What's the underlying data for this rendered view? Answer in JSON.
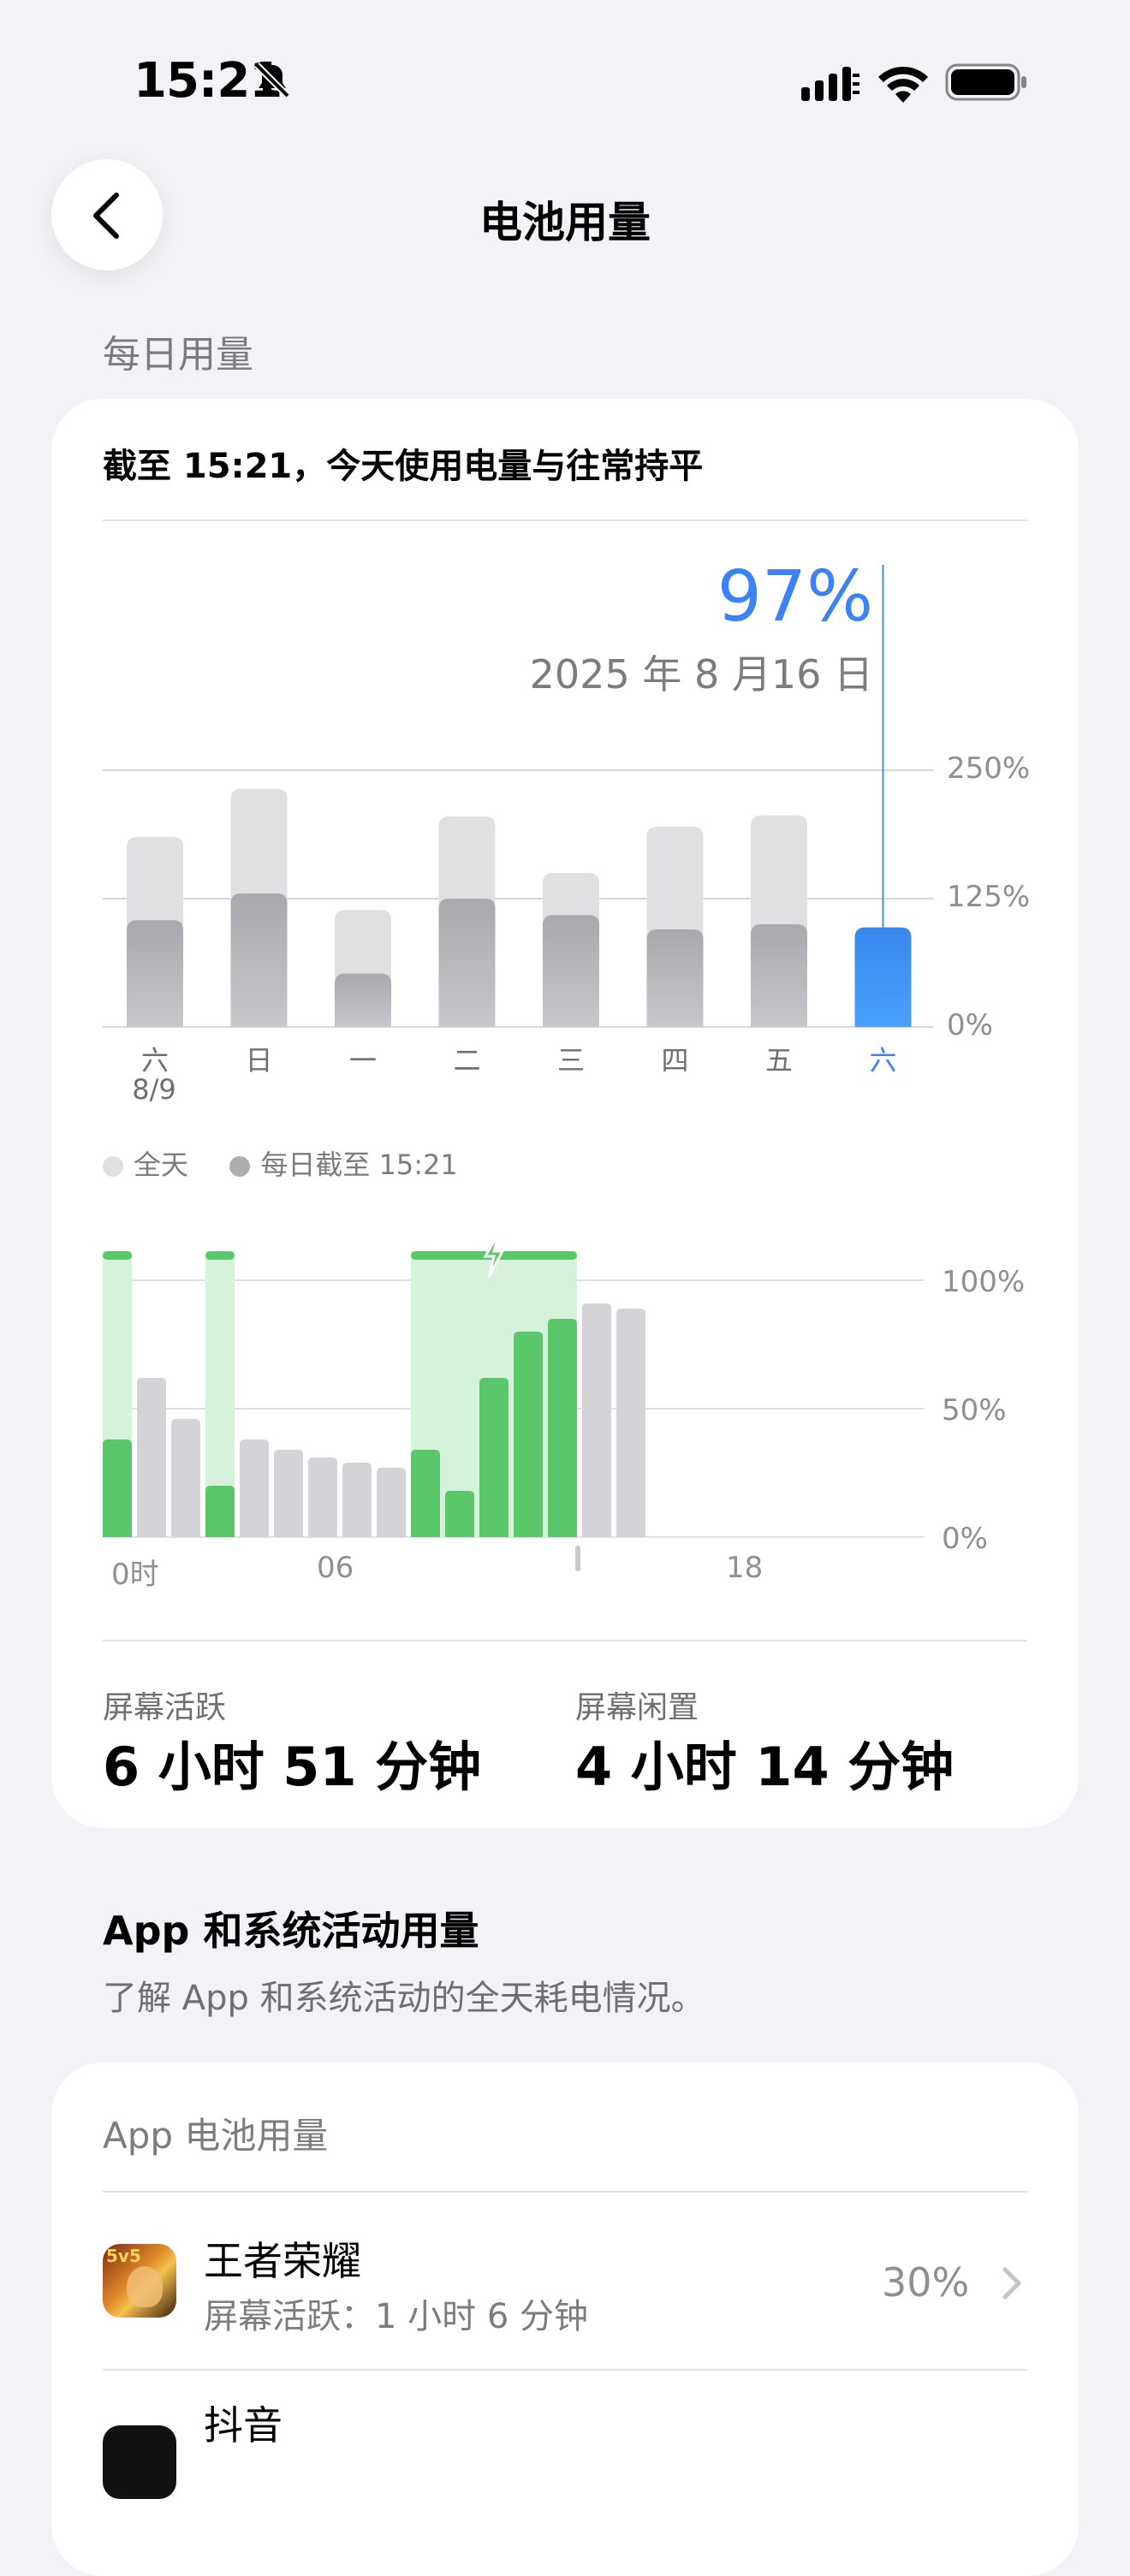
{
  "status_bar": {
    "time": "15:21"
  },
  "nav": {
    "title": "电池用量"
  },
  "daily": {
    "section_label": "每日用量",
    "summary": "截至 15:21，今天使用电量与往常持平",
    "selected_percent": "97%",
    "selected_date": "2025 年 8 月16 日",
    "y_axis_labels": [
      "250%",
      "125%",
      "0%"
    ],
    "legend": {
      "all_day": "全天",
      "until_now": "每日截至 15:21"
    }
  },
  "chart_data": [
    {
      "type": "bar",
      "categories": [
        "六",
        "日",
        "一",
        "二",
        "三",
        "四",
        "五",
        "六"
      ],
      "first_category_sublabel": "8/9",
      "series": [
        {
          "name": "全天",
          "values": [
            185,
            232,
            114,
            205,
            150,
            195,
            206,
            null
          ]
        },
        {
          "name": "每日截至 15:21",
          "values": [
            104,
            130,
            52,
            125,
            109,
            95,
            100,
            97
          ]
        }
      ],
      "ylim": [
        0,
        250
      ],
      "yticks": [
        "250%",
        "125%",
        "0%"
      ],
      "selected_index": 7,
      "colors": {
        "all_day": "#e0e0e3",
        "until_now": "#aeaeb2",
        "selected": "#3b8ef3"
      }
    },
    {
      "type": "bar",
      "x_labels": [
        "0时",
        "06",
        "18"
      ],
      "yticks": [
        "100%",
        "50%",
        "0%"
      ],
      "values": [
        38,
        62,
        46,
        20,
        38,
        34,
        31,
        29,
        27,
        34,
        18,
        62,
        80,
        85,
        91,
        89
      ],
      "charging": [
        true,
        false,
        false,
        true,
        false,
        false,
        false,
        false,
        false,
        true,
        true,
        true,
        true,
        true,
        false,
        false
      ],
      "ylim": [
        0,
        100
      ],
      "colors": {
        "charging": "#5ac86a",
        "charging_bg": "#d6f2da",
        "normal": "#d4d4d8"
      }
    }
  ],
  "stats": {
    "active_label": "屏幕活跃",
    "active_value": "6 小时 51 分钟",
    "idle_label": "屏幕闲置",
    "idle_value": "4 小时 14 分钟"
  },
  "app_section": {
    "title": "App 和系统活动用量",
    "subtitle": "了解 App 和系统活动的全天耗电情况。",
    "card_label": "App 电池用量",
    "apps": [
      {
        "name": "王者荣耀",
        "detail": "屏幕活跃：1 小时 6 分钟",
        "percent": "30%",
        "icon": "game-icon"
      },
      {
        "name": "抖音",
        "detail": "",
        "percent": "",
        "icon": "douyin-icon"
      }
    ]
  }
}
